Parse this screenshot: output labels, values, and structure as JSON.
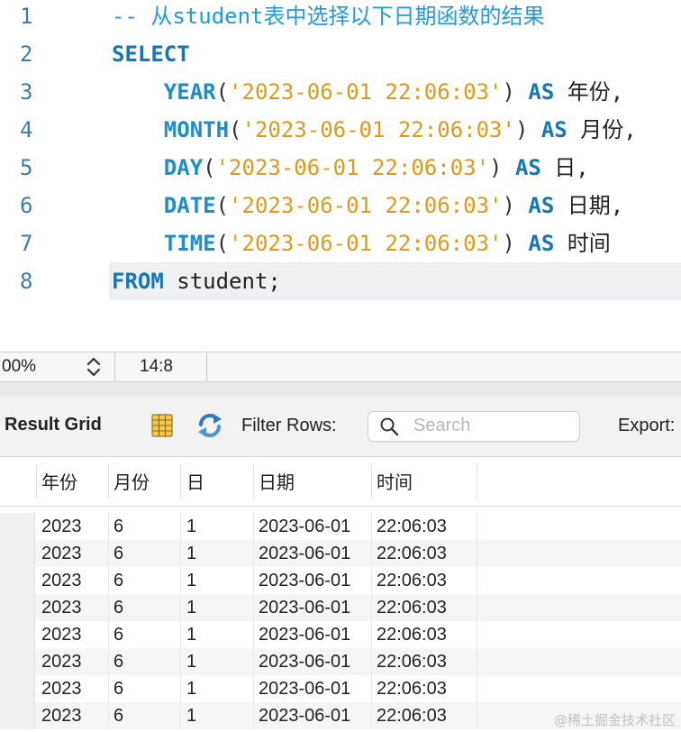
{
  "editor": {
    "lines": [
      {
        "number": "1",
        "parts": [
          {
            "cls": "comment",
            "text": "-- 从student表中选择以下日期函数的结果"
          }
        ]
      },
      {
        "number": "2",
        "parts": [
          {
            "cls": "kw",
            "text": "SELECT"
          }
        ]
      },
      {
        "number": "3",
        "parts": [
          {
            "cls": "plain",
            "text": "    "
          },
          {
            "cls": "fn",
            "text": "YEAR"
          },
          {
            "cls": "punct",
            "text": "("
          },
          {
            "cls": "str",
            "text": "'2023-06-01 22:06:03'"
          },
          {
            "cls": "punct",
            "text": ") "
          },
          {
            "cls": "kw",
            "text": "AS"
          },
          {
            "cls": "plain",
            "text": " 年份,"
          }
        ]
      },
      {
        "number": "4",
        "parts": [
          {
            "cls": "plain",
            "text": "    "
          },
          {
            "cls": "fn",
            "text": "MONTH"
          },
          {
            "cls": "punct",
            "text": "("
          },
          {
            "cls": "str",
            "text": "'2023-06-01 22:06:03'"
          },
          {
            "cls": "punct",
            "text": ") "
          },
          {
            "cls": "kw",
            "text": "AS"
          },
          {
            "cls": "plain",
            "text": " 月份,"
          }
        ]
      },
      {
        "number": "5",
        "parts": [
          {
            "cls": "plain",
            "text": "    "
          },
          {
            "cls": "fn",
            "text": "DAY"
          },
          {
            "cls": "punct",
            "text": "("
          },
          {
            "cls": "str",
            "text": "'2023-06-01 22:06:03'"
          },
          {
            "cls": "punct",
            "text": ") "
          },
          {
            "cls": "kw",
            "text": "AS"
          },
          {
            "cls": "plain",
            "text": " 日,"
          }
        ]
      },
      {
        "number": "6",
        "parts": [
          {
            "cls": "plain",
            "text": "    "
          },
          {
            "cls": "fn",
            "text": "DATE"
          },
          {
            "cls": "punct",
            "text": "("
          },
          {
            "cls": "str",
            "text": "'2023-06-01 22:06:03'"
          },
          {
            "cls": "punct",
            "text": ") "
          },
          {
            "cls": "kw",
            "text": "AS"
          },
          {
            "cls": "plain",
            "text": " 日期,"
          }
        ]
      },
      {
        "number": "7",
        "parts": [
          {
            "cls": "plain",
            "text": "    "
          },
          {
            "cls": "fn",
            "text": "TIME"
          },
          {
            "cls": "punct",
            "text": "("
          },
          {
            "cls": "str",
            "text": "'2023-06-01 22:06:03'"
          },
          {
            "cls": "punct",
            "text": ") "
          },
          {
            "cls": "kw",
            "text": "AS"
          },
          {
            "cls": "plain",
            "text": " 时间"
          }
        ]
      },
      {
        "number": "8",
        "current": true,
        "parts": [
          {
            "cls": "kw",
            "text": "FROM"
          },
          {
            "cls": "plain",
            "text": " student;"
          }
        ]
      }
    ]
  },
  "statusbar": {
    "zoom": "00%",
    "cursor": "14:8"
  },
  "toolbar": {
    "title": "Result Grid",
    "grid_icon": "grid-view-icon",
    "refresh_icon": "refresh-icon",
    "filter_label": "Filter Rows:",
    "search_placeholder": "Search",
    "search_value": "",
    "export_label": "Export:"
  },
  "grid": {
    "columns": [
      "年份",
      "月份",
      "日",
      "日期",
      "时间"
    ],
    "rows": [
      [
        "2023",
        "6",
        "1",
        "2023-06-01",
        "22:06:03"
      ],
      [
        "2023",
        "6",
        "1",
        "2023-06-01",
        "22:06:03"
      ],
      [
        "2023",
        "6",
        "1",
        "2023-06-01",
        "22:06:03"
      ],
      [
        "2023",
        "6",
        "1",
        "2023-06-01",
        "22:06:03"
      ],
      [
        "2023",
        "6",
        "1",
        "2023-06-01",
        "22:06:03"
      ],
      [
        "2023",
        "6",
        "1",
        "2023-06-01",
        "22:06:03"
      ],
      [
        "2023",
        "6",
        "1",
        "2023-06-01",
        "22:06:03"
      ],
      [
        "2023",
        "6",
        "1",
        "2023-06-01",
        "22:06:03"
      ]
    ]
  },
  "watermark": "@稀土掘金技术社区",
  "colors": {
    "keyword": "#1576b8",
    "function": "#1a8ecf",
    "string": "#e09a18",
    "comment": "#1f9be0",
    "line_number": "#3c7ea8"
  }
}
